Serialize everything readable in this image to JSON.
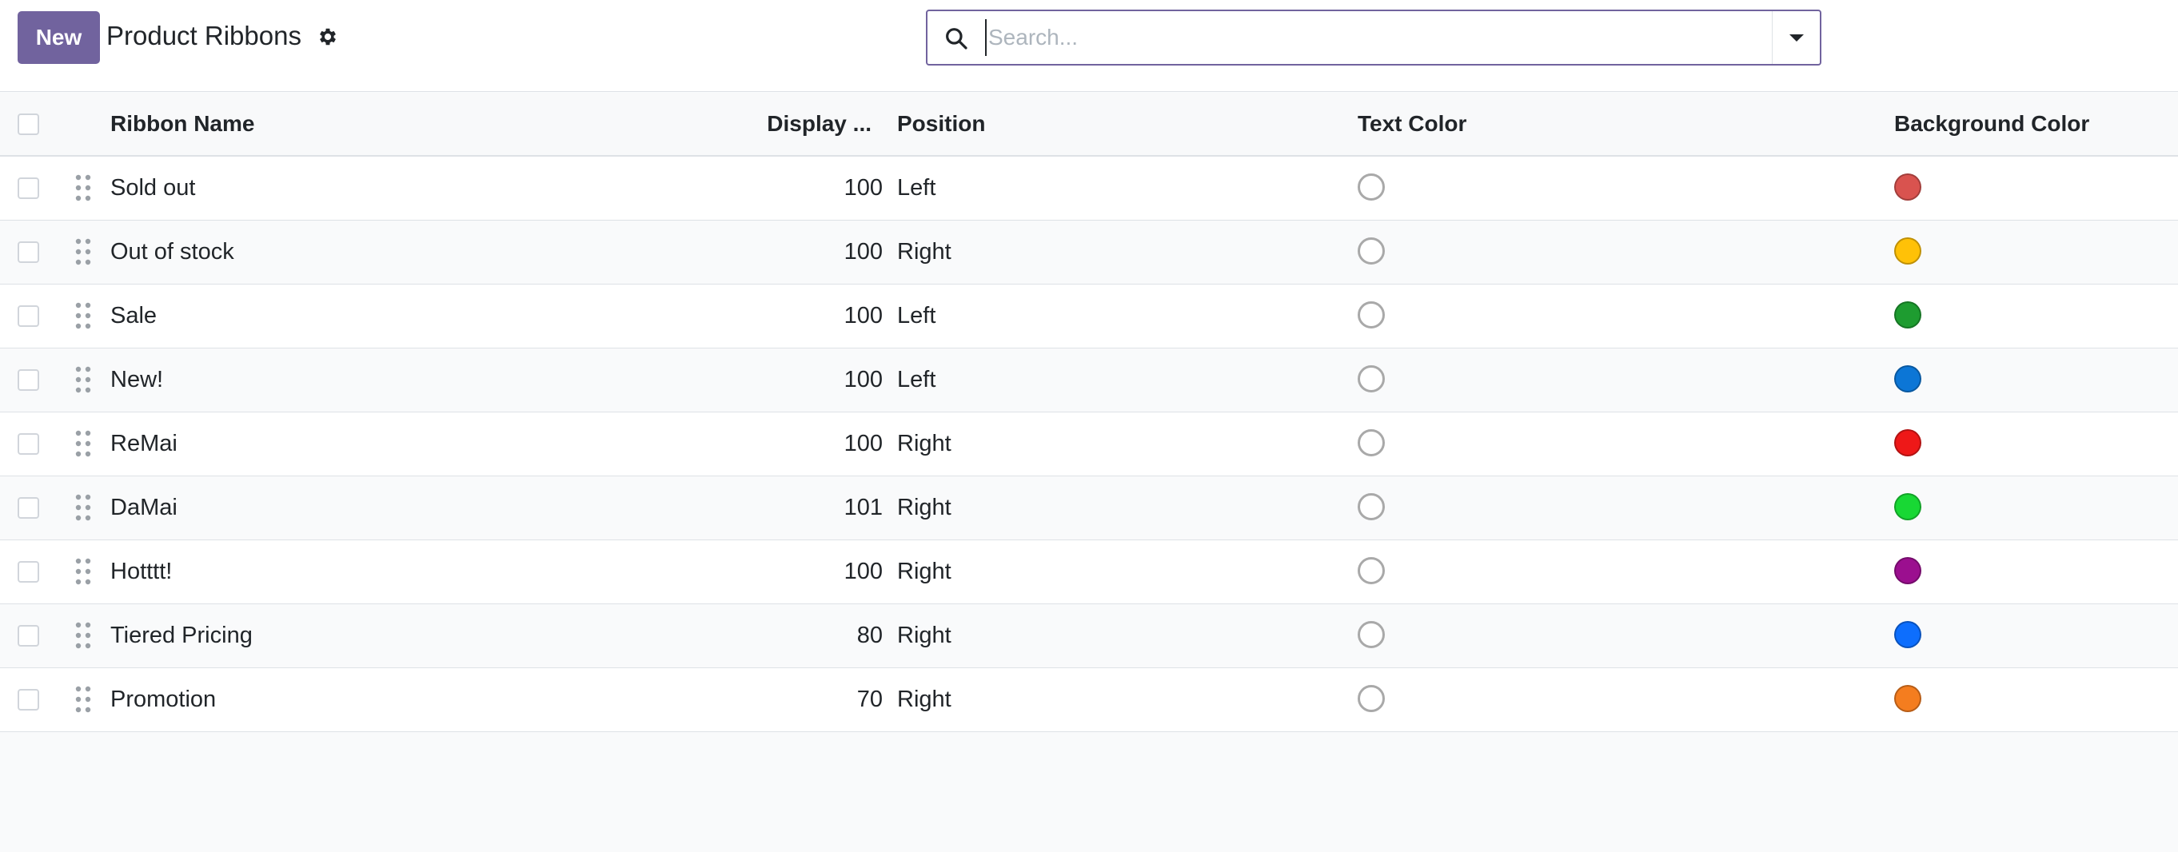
{
  "control_panel": {
    "new_label": "New",
    "title": "Product Ribbons",
    "search_placeholder": "Search..."
  },
  "table": {
    "headers": {
      "name": "Ribbon Name",
      "sequence": "Display ...",
      "position": "Position",
      "text_color": "Text Color",
      "bg_color": "Background Color"
    },
    "rows": [
      {
        "name": "Sold out",
        "sequence": "100",
        "position": "Left",
        "text_color": "#ffffff",
        "bg_color": "#d9534f"
      },
      {
        "name": "Out of stock",
        "sequence": "100",
        "position": "Right",
        "text_color": "#ffffff",
        "bg_color": "#ffc107"
      },
      {
        "name": "Sale",
        "sequence": "100",
        "position": "Left",
        "text_color": "#ffffff",
        "bg_color": "#1e9c30"
      },
      {
        "name": "New!",
        "sequence": "100",
        "position": "Left",
        "text_color": "#ffffff",
        "bg_color": "#0c76d6"
      },
      {
        "name": "ReMai",
        "sequence": "100",
        "position": "Right",
        "text_color": "#ffffff",
        "bg_color": "#ee1818"
      },
      {
        "name": "DaMai",
        "sequence": "101",
        "position": "Right",
        "text_color": "#ffffff",
        "bg_color": "#18d834"
      },
      {
        "name": "Hotttt!",
        "sequence": "100",
        "position": "Right",
        "text_color": "#ffffff",
        "bg_color": "#9b0f8f"
      },
      {
        "name": "Tiered Pricing",
        "sequence": "80",
        "position": "Right",
        "text_color": "#ffffff",
        "bg_color": "#0d6efd"
      },
      {
        "name": "Promotion",
        "sequence": "70",
        "position": "Right",
        "text_color": "#ffffff",
        "bg_color": "#f47d1f"
      }
    ]
  }
}
